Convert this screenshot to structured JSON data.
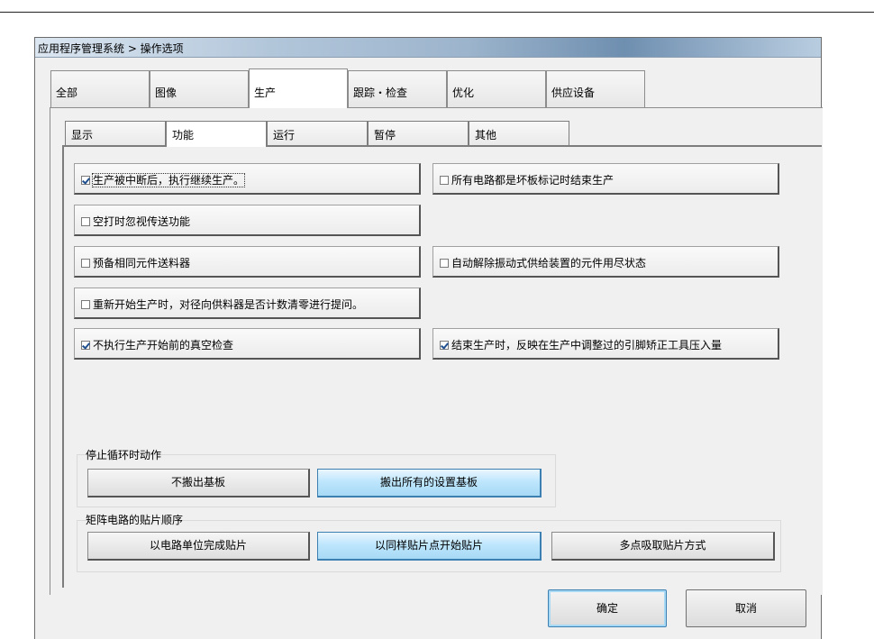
{
  "window": {
    "title": "应用程序管理系统 > 操作选项"
  },
  "main_tabs": [
    {
      "label": "全部"
    },
    {
      "label": "图像"
    },
    {
      "label": "生产",
      "active": true
    },
    {
      "label": "跟踪・检查"
    },
    {
      "label": "优化"
    },
    {
      "label": "供应设备"
    }
  ],
  "sub_tabs": [
    {
      "label": "显示"
    },
    {
      "label": "功能",
      "active": true
    },
    {
      "label": "运行"
    },
    {
      "label": "暂停"
    },
    {
      "label": "其他"
    }
  ],
  "options": {
    "resume_after_interrupt": {
      "label": "生产被中断后，执行继续生产。",
      "checked": true
    },
    "ignore_transfer_on_empty": {
      "label": "空打时忽视传送功能",
      "checked": false
    },
    "standby_same_feeder": {
      "label": "预备相同元件送料器",
      "checked": false
    },
    "radial_feeder_prompt": {
      "label": "重新开始生产时，对径向供料器是否计数清零进行提问。",
      "checked": false
    },
    "skip_vacuum_check": {
      "label": "不执行生产开始前的真空检查",
      "checked": true
    },
    "end_on_all_bad_marks": {
      "label": "所有电路都是坏板标记时结束生产",
      "checked": false
    },
    "auto_release_vibratory": {
      "label": "自动解除振动式供给装置的元件用尽状态",
      "checked": false
    },
    "reflect_clinch_tool": {
      "label": "结束生产时，反映在生产中调整过的引脚矫正工具压入量",
      "checked": true
    }
  },
  "stop_cycle_group": {
    "label": "停止循环时动作",
    "buttons": [
      {
        "label": "不搬出基板",
        "selected": false
      },
      {
        "label": "搬出所有的设置基板",
        "selected": true
      }
    ]
  },
  "matrix_order_group": {
    "label": "矩阵电路的贴片顺序",
    "buttons": [
      {
        "label": "以电路单位完成贴片",
        "selected": false
      },
      {
        "label": "以同样贴片点开始贴片",
        "selected": true
      },
      {
        "label": "多点吸取贴片方式",
        "selected": false
      }
    ]
  },
  "footer": {
    "ok_label": "确定",
    "cancel_label": "取消"
  },
  "colors": {
    "selected_button": "#bee6fd",
    "check_mark": "#1e4f8f",
    "panel_bg": "#f0f0f0"
  }
}
